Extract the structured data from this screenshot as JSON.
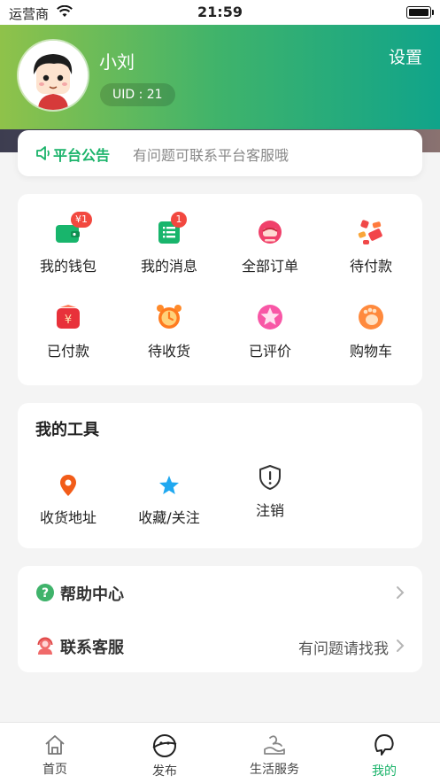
{
  "status_bar": {
    "carrier": "运营商",
    "time": "21:59"
  },
  "profile": {
    "name": "小刘",
    "uid": "UID : 21",
    "settings_label": "设置"
  },
  "notice": {
    "title": "平台公告",
    "text": "有问题可联系平台客服哦"
  },
  "orders": {
    "items": [
      {
        "label": "我的钱包",
        "icon": "wallet-icon",
        "badge": "¥1"
      },
      {
        "label": "我的消息",
        "icon": "message-list-icon",
        "badge": "1"
      },
      {
        "label": "全部订单",
        "icon": "all-orders-icon"
      },
      {
        "label": "待付款",
        "icon": "pending-payment-icon"
      },
      {
        "label": "已付款",
        "icon": "paid-icon"
      },
      {
        "label": "待收货",
        "icon": "alarm-clock-icon"
      },
      {
        "label": "已评价",
        "icon": "star-review-icon"
      },
      {
        "label": "购物车",
        "icon": "shopping-cart-icon"
      }
    ]
  },
  "tools": {
    "title": "我的工具",
    "items": [
      {
        "label": "收货地址",
        "icon": "location-pin-icon"
      },
      {
        "label": "收藏/关注",
        "icon": "star-icon"
      },
      {
        "label": "注销",
        "icon": "shield-alert-icon"
      }
    ]
  },
  "links": {
    "help": {
      "label": "帮助中心",
      "icon": "question-icon"
    },
    "service": {
      "label": "联系客服",
      "value": "有问题请找我",
      "icon": "customer-service-icon"
    }
  },
  "tabbar": {
    "tabs": [
      {
        "label": "首页",
        "icon": "home-icon"
      },
      {
        "label": "发布",
        "icon": "publish-icon"
      },
      {
        "label": "生活服务",
        "icon": "life-service-icon"
      },
      {
        "label": "我的",
        "icon": "profile-icon",
        "active": true
      }
    ]
  },
  "colors": {
    "accent": "#1ab36a",
    "header_start": "#8fc24a",
    "header_end": "#10a48a",
    "badge": "#f2483f"
  }
}
